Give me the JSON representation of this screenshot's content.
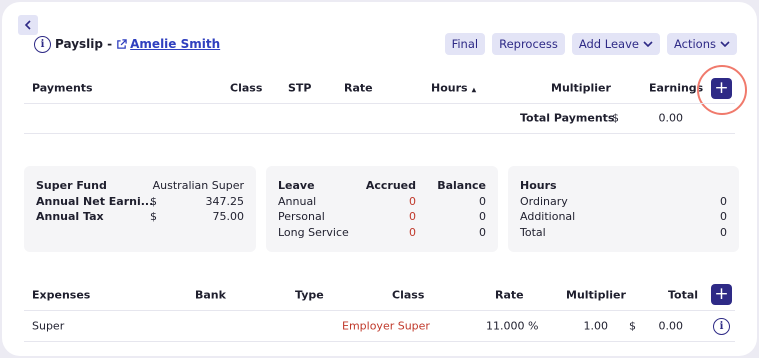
{
  "header": {
    "title": "Payslip -",
    "employee_name": "Amelie Smith",
    "actions": [
      "Final",
      "Reprocess",
      "Add Leave",
      "Actions"
    ]
  },
  "payments": {
    "columns": [
      "Payments",
      "Class",
      "STP",
      "Rate",
      "Hours",
      "Multiplier",
      "Earnings"
    ],
    "sort_indicator": "▲",
    "add_label": "+",
    "total_label": "Total Payments",
    "total_currency": "$",
    "total_value": "0.00"
  },
  "summary": {
    "super_fund_label": "Super Fund",
    "super_fund_value": "Australian Super",
    "net_label": "Annual Net Earni...",
    "net_currency": "$",
    "net_value": "347.25",
    "tax_label": "Annual Tax",
    "tax_currency": "$",
    "tax_value": "75.00"
  },
  "leave": {
    "columns": [
      "Leave",
      "Accrued",
      "Balance"
    ],
    "rows": [
      {
        "name": "Annual",
        "accrued": "0",
        "balance": "0"
      },
      {
        "name": "Personal",
        "accrued": "0",
        "balance": "0"
      },
      {
        "name": "Long Service",
        "accrued": "0",
        "balance": "0"
      }
    ]
  },
  "hours": {
    "title": "Hours",
    "rows": [
      {
        "name": "Ordinary",
        "value": "0"
      },
      {
        "name": "Additional",
        "value": "0"
      },
      {
        "name": "Total",
        "value": "0"
      }
    ]
  },
  "expenses": {
    "columns": [
      "Expenses",
      "Bank",
      "Type",
      "Class",
      "Rate",
      "Multiplier",
      "Total"
    ],
    "add_label": "+",
    "rows": [
      {
        "expense": "Super",
        "class": "Employer Super",
        "rate": "11.000 %",
        "multiplier": "1.00",
        "currency": "$",
        "total": "0.00"
      }
    ]
  },
  "colors": {
    "accent": "#2e2a86",
    "link": "#2f3fbf",
    "pill_bg": "#e3e4f6",
    "red": "#c0392b",
    "highlight": "#f07a6c"
  }
}
